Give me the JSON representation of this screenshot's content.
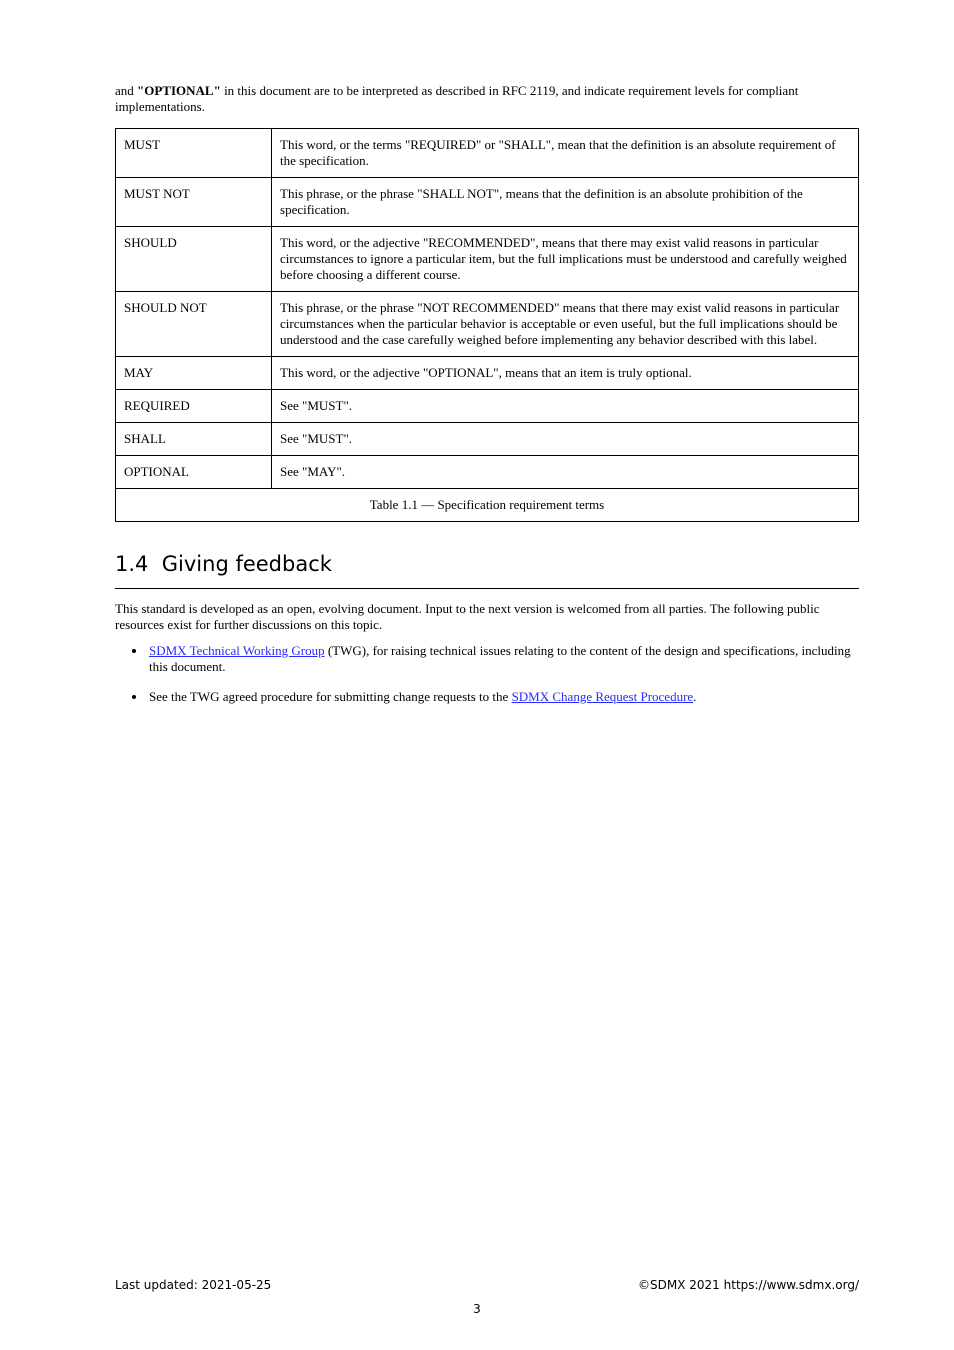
{
  "intro_phrase_prefix": "and ",
  "intro_phrase_bold": "\"OPTIONAL\"",
  "intro_phrase_text": " in this document are to be interpreted as described in RFC 2119, and indicate requirement levels for compliant implementations.",
  "table": {
    "rows": [
      {
        "term": "MUST",
        "desc": "This word, or the terms \"REQUIRED\" or \"SHALL\", mean that the definition is an absolute requirement of the specification."
      },
      {
        "term": "MUST NOT",
        "desc": "This phrase, or the phrase \"SHALL NOT\", means that the definition is an absolute prohibition of the specification."
      },
      {
        "term": "SHOULD",
        "desc": "This word, or the adjective \"RECOMMENDED\", means that there may exist valid reasons in particular circumstances to ignore a particular item, but the full implications must be understood and carefully weighed before choosing a different course."
      },
      {
        "term": "SHOULD NOT",
        "desc": "This phrase, or the phrase \"NOT RECOMMENDED\" means that there may exist valid reasons in particular circumstances when the particular behavior is acceptable or even useful, but the full implications should be understood and the case carefully weighed before implementing any behavior described with this label."
      },
      {
        "term": "MAY",
        "desc": "This word, or the adjective \"OPTIONAL\", means that an item is truly optional."
      },
      {
        "term": "REQUIRED",
        "desc": "See \"MUST\"."
      },
      {
        "term": "SHALL",
        "desc": "See \"MUST\"."
      },
      {
        "term": "OPTIONAL",
        "desc": "See \"MAY\"."
      }
    ],
    "caption": "Table 1.1 — Specification requirement terms"
  },
  "section": {
    "number": "1.4",
    "title": "Giving feedback"
  },
  "body": {
    "p1": "This standard is developed as an open, evolving document. Input to the next version is welcomed from all parties. The following public resources exist for further discussions on this topic.",
    "li1_link": "SDMX Technical Working Group",
    "li1_rest": " (TWG), for raising technical issues relating to the content of the design and specifications, including this document.",
    "li2_pre": "See the TWG agreed procedure for submitting change requests to the ",
    "li2_link": "SDMX Change Request Procedure",
    "li2_post": "."
  },
  "footer": {
    "left": "Last updated: 2021-05-25",
    "right": "©SDMX 2021 https://www.sdmx.org/"
  },
  "page_number": "3"
}
